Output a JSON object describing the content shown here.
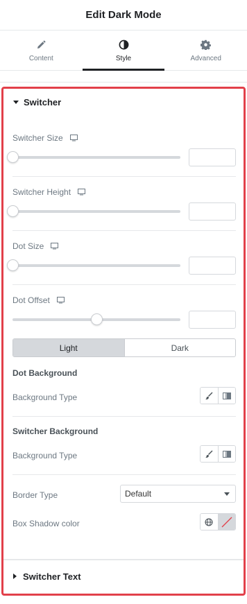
{
  "header": {
    "title": "Edit Dark Mode"
  },
  "tabs": [
    {
      "label": "Content",
      "icon": "pencil-icon"
    },
    {
      "label": "Style",
      "icon": "contrast-icon",
      "active": true
    },
    {
      "label": "Advanced",
      "icon": "gear-icon"
    }
  ],
  "switcher_section": {
    "title": "Switcher",
    "controls": [
      {
        "label": "Switcher Size",
        "value": "",
        "slider_fraction": 0
      },
      {
        "label": "Switcher Height",
        "value": "",
        "slider_fraction": 0
      },
      {
        "label": "Dot Size",
        "value": "",
        "slider_fraction": 0
      },
      {
        "label": "Dot Offset",
        "value": "",
        "slider_fraction": 0.5
      }
    ],
    "mode_switch": {
      "options": [
        "Light",
        "Dark"
      ],
      "selected": "Light"
    },
    "dot_background": {
      "heading": "Dot Background",
      "type_label": "Background Type"
    },
    "switcher_background": {
      "heading": "Switcher Background",
      "type_label": "Background Type"
    },
    "border_type": {
      "label": "Border Type",
      "value": "Default"
    },
    "box_shadow": {
      "label": "Box Shadow color"
    }
  },
  "switcher_text_section": {
    "title": "Switcher Text"
  },
  "colors": {
    "highlight_border": "#e2404a",
    "active_tab": "#1f2124"
  }
}
